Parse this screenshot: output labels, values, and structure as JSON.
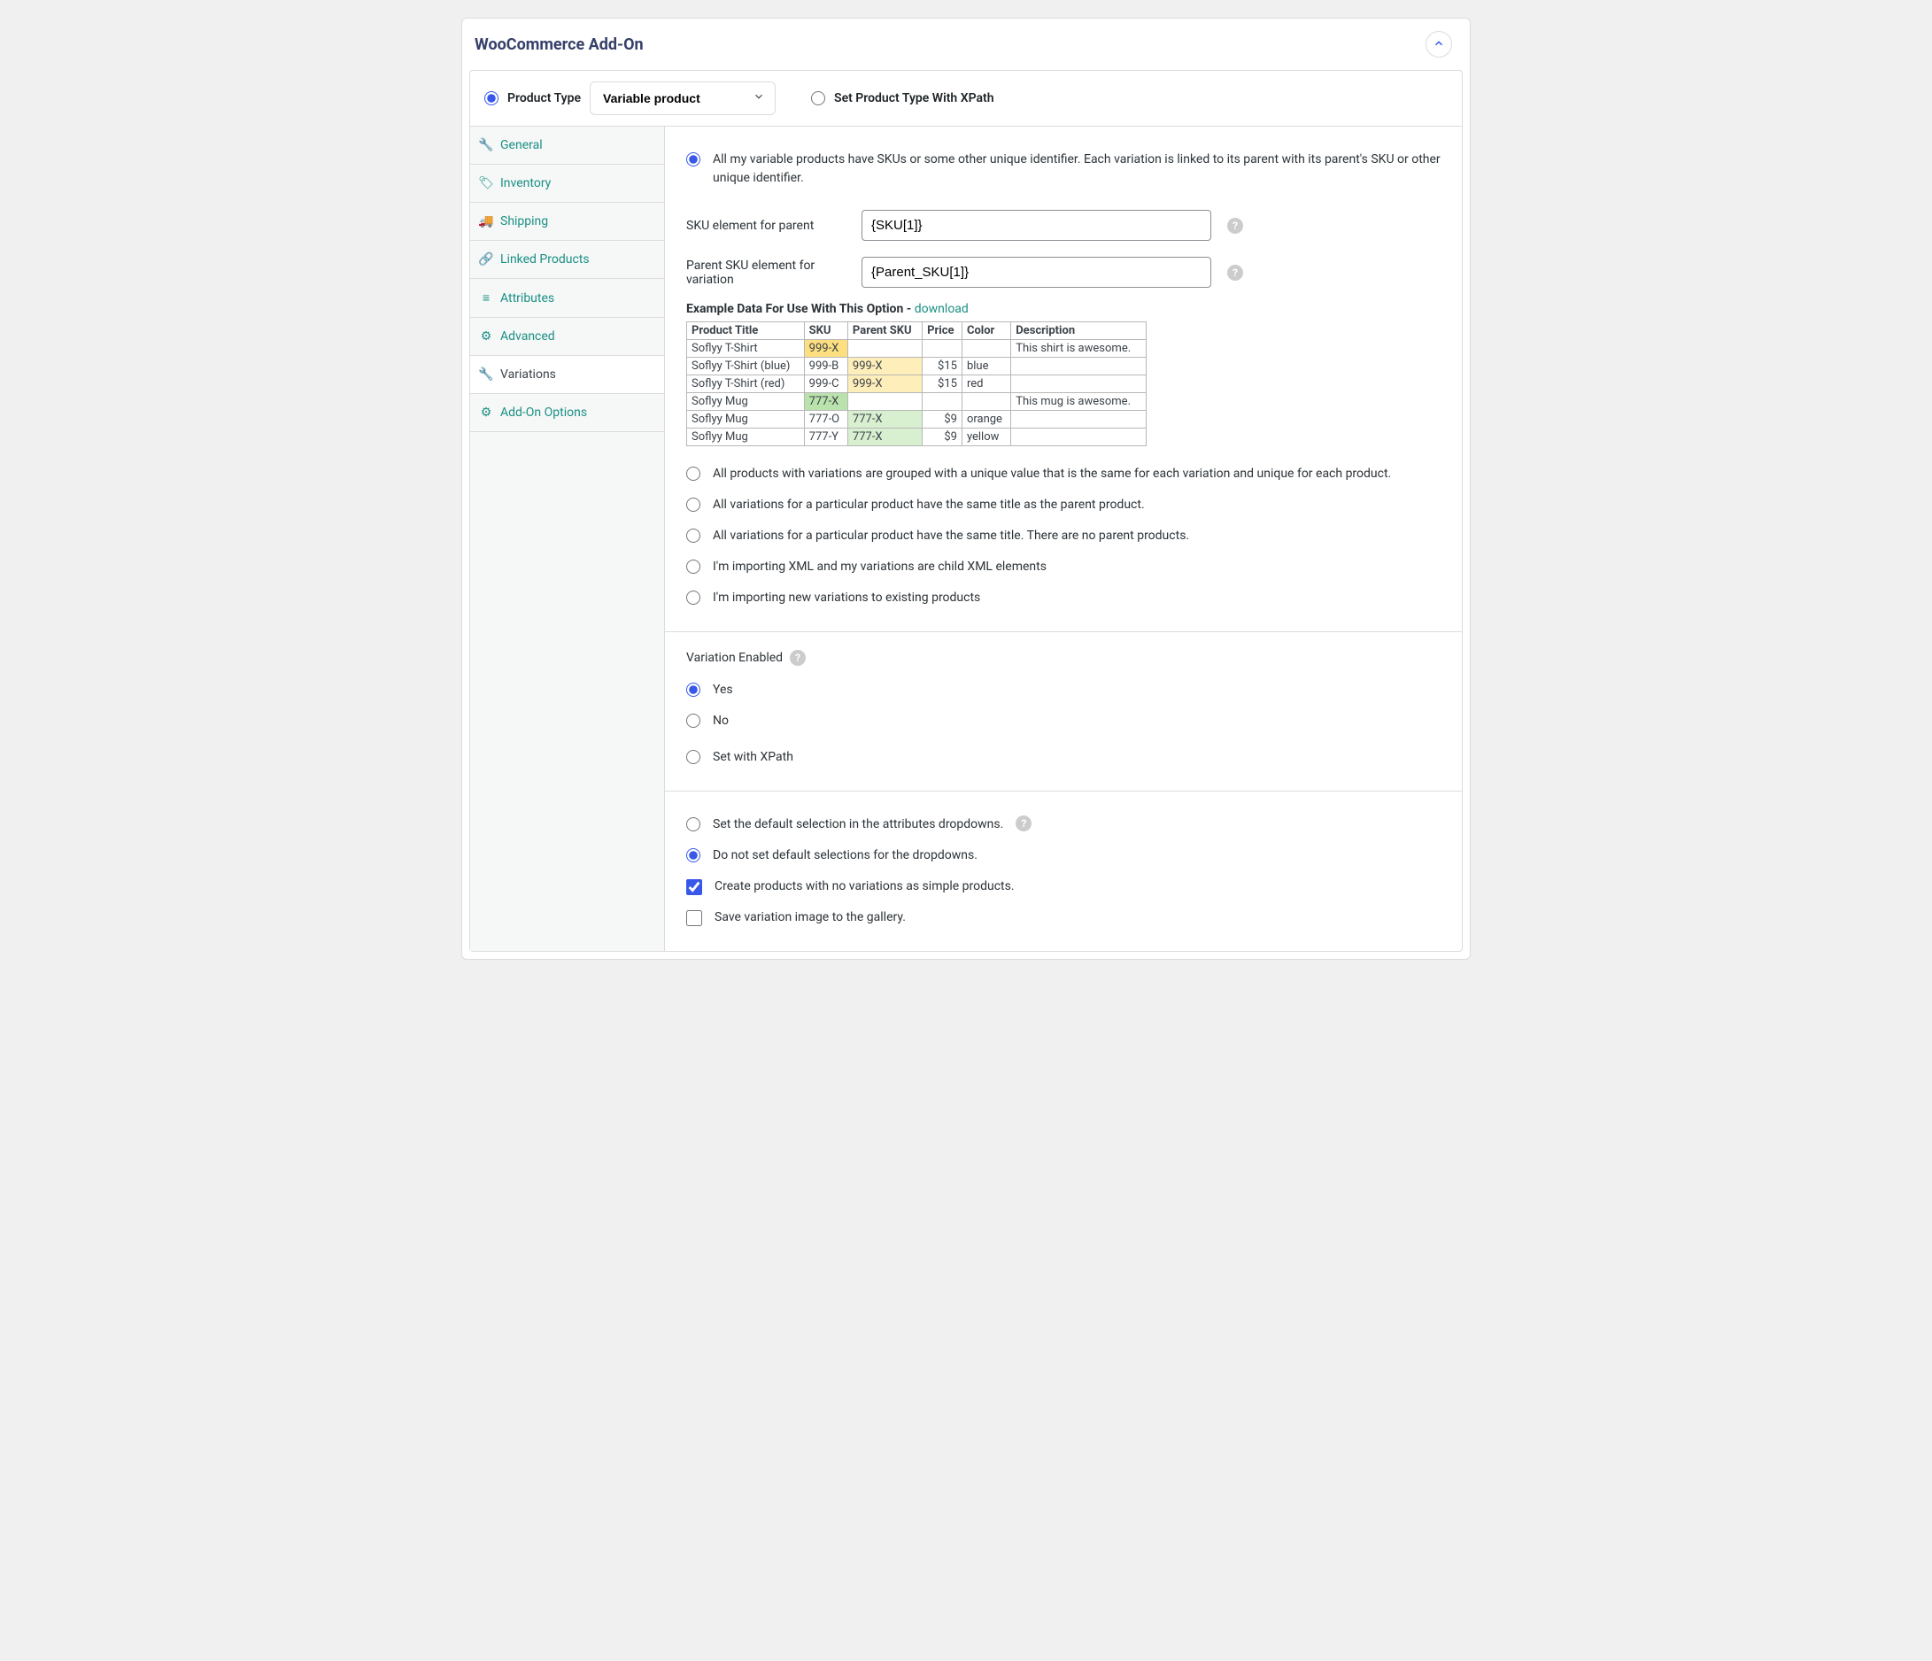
{
  "panel": {
    "title": "WooCommerce Add-On"
  },
  "topbar": {
    "product_type_label": "Product Type",
    "product_type_value": "Variable product",
    "xpath_label": "Set Product Type With XPath"
  },
  "sidebar": {
    "items": [
      {
        "label": "General",
        "icon": "wrench"
      },
      {
        "label": "Inventory",
        "icon": "tag"
      },
      {
        "label": "Shipping",
        "icon": "truck"
      },
      {
        "label": "Linked Products",
        "icon": "link"
      },
      {
        "label": "Attributes",
        "icon": "list"
      },
      {
        "label": "Advanced",
        "icon": "gear"
      },
      {
        "label": "Variations",
        "icon": "wrench",
        "active": true
      },
      {
        "label": "Add-On Options",
        "icon": "gear"
      }
    ]
  },
  "variations": {
    "method_options": [
      "All my variable products have SKUs or some other unique identifier. Each variation is linked to its parent with its parent's SKU or other unique identifier.",
      "All products with variations are grouped with a unique value that is the same for each variation and unique for each product.",
      "All variations for a particular product have the same title as the parent product.",
      "All variations for a particular product have the same title. There are no parent products.",
      "I'm importing XML and my variations are child XML elements",
      "I'm importing new variations to existing products"
    ],
    "fields": {
      "sku_parent_label": "SKU element for parent",
      "sku_parent_value": "{SKU[1]}",
      "parent_sku_var_label": "Parent SKU element for variation",
      "parent_sku_var_value": "{Parent_SKU[1]}"
    },
    "example": {
      "heading": "Example Data For Use With This Option - ",
      "download": "download",
      "columns": [
        "Product Title",
        "SKU",
        "Parent SKU",
        "Price",
        "Color",
        "Description"
      ],
      "rows": [
        {
          "title": "Soflyy T-Shirt",
          "sku": "999-X",
          "parent": "",
          "price": "",
          "color": "",
          "desc": "This shirt is awesome."
        },
        {
          "title": "Soflyy T-Shirt (blue)",
          "sku": "999-B",
          "parent": "999-X",
          "price": "$15",
          "color": "blue",
          "desc": ""
        },
        {
          "title": "Soflyy T-Shirt (red)",
          "sku": "999-C",
          "parent": "999-X",
          "price": "$15",
          "color": "red",
          "desc": ""
        },
        {
          "title": "Soflyy Mug",
          "sku": "777-X",
          "parent": "",
          "price": "",
          "color": "",
          "desc": "This mug is awesome."
        },
        {
          "title": "Soflyy Mug",
          "sku": "777-O",
          "parent": "777-X",
          "price": "$9",
          "color": "orange",
          "desc": ""
        },
        {
          "title": "Soflyy Mug",
          "sku": "777-Y",
          "parent": "777-X",
          "price": "$9",
          "color": "yellow",
          "desc": ""
        }
      ]
    }
  },
  "variation_enabled": {
    "heading": "Variation Enabled",
    "options": [
      "Yes",
      "No",
      "Set with XPath"
    ]
  },
  "defaults": {
    "opt1": "Set the default selection in the attributes dropdowns.",
    "opt2": "Do not set default selections for the dropdowns.",
    "opt3": "Create products with no variations as simple products.",
    "opt4": "Save variation image to the gallery."
  }
}
